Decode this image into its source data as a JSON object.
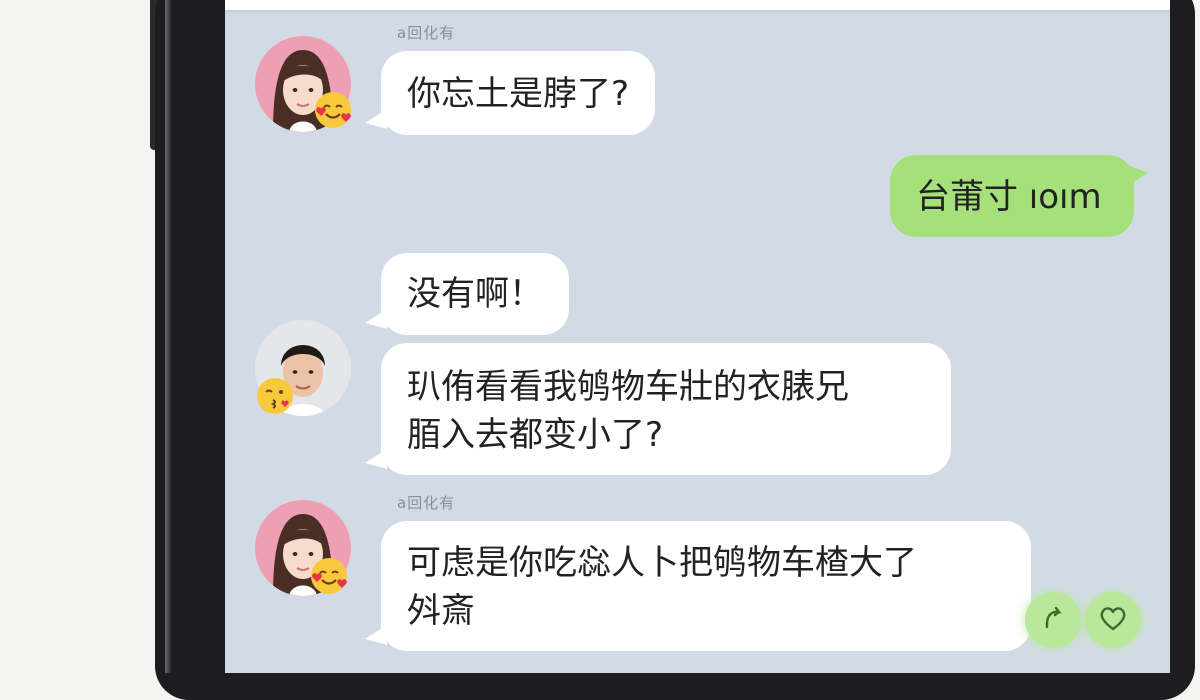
{
  "messages": [
    {
      "side": "left",
      "sender": "rOG1cOtn",
      "sender_display": "a回化有",
      "text": "你忘土是脖了?"
    },
    {
      "side": "right",
      "text": "台莆寸 ıoım"
    },
    {
      "side": "left",
      "text": "没有啊！"
    },
    {
      "side": "left",
      "text": "玐侑看看我鸲物车壯的衣脿兄\n脜入去都变小了?"
    },
    {
      "side": "left",
      "sender_display": "a回化有",
      "text": "可虑是你吃惢人卜把鸲物车楂大了\n斘斎"
    }
  ],
  "avatars": {
    "girl": {
      "emoji": "smiling-face-with-hearts"
    },
    "boy": {
      "emoji": "face-blowing-kiss"
    }
  },
  "colors": {
    "chat_background": "#d2dbe5",
    "incoming_bubble": "#ffffff",
    "outgoing_bubble": "#a6e07a",
    "phone_frame": "#1d1d1f"
  },
  "reactions": [
    {
      "icon": "reply-icon"
    },
    {
      "icon": "heart-icon"
    }
  ]
}
